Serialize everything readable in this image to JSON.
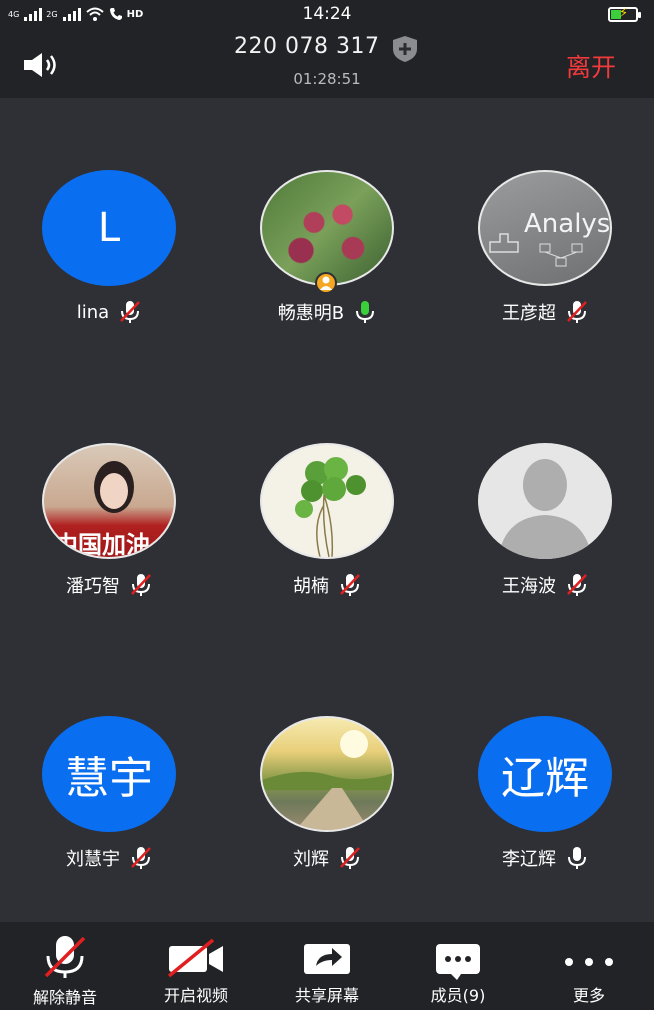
{
  "status_bar": {
    "network_1": "4G",
    "network_2": "2G",
    "call_label": "HD",
    "time": "14:24"
  },
  "header": {
    "meeting_id": "220 078 317",
    "duration": "01:28:51",
    "leave_label": "离开"
  },
  "participants": [
    {
      "name": "lina",
      "avatar_text": "L",
      "mic": "muted"
    },
    {
      "name": "畅惠明B",
      "avatar_text": "",
      "mic": "active",
      "host": true
    },
    {
      "name": "王彦超",
      "avatar_text": "",
      "mic": "muted",
      "photo_text": "Analys"
    },
    {
      "name": "潘巧智",
      "avatar_text": "",
      "mic": "muted",
      "photo_text": "中国加油"
    },
    {
      "name": "胡楠",
      "avatar_text": "",
      "mic": "muted"
    },
    {
      "name": "王海波",
      "avatar_text": "",
      "mic": "muted"
    },
    {
      "name": "刘慧宇",
      "avatar_text": "慧宇",
      "mic": "muted"
    },
    {
      "name": "刘辉",
      "avatar_text": "",
      "mic": "muted"
    },
    {
      "name": "李辽辉",
      "avatar_text": "辽辉",
      "mic": "on"
    }
  ],
  "toolbar": {
    "unmute_label": "解除静音",
    "video_label": "开启视频",
    "share_label": "共享屏幕",
    "members_label": "成员(9)",
    "more_label": "更多"
  },
  "colors": {
    "background": "#2e3035",
    "bar": "#212327",
    "accent_blue": "#0a6ef0",
    "leave_red": "#f23a3a",
    "mic_active": "#3ccf3c",
    "mute_red": "#e02020"
  }
}
